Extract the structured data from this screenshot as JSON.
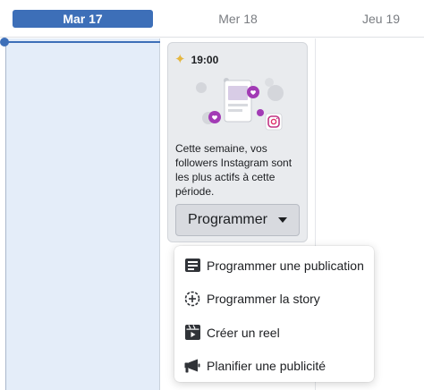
{
  "header": {
    "days": [
      {
        "label": "Mar 17",
        "active": true
      },
      {
        "label": "Mer 18",
        "active": false
      },
      {
        "label": "Jeu 19",
        "active": false
      }
    ]
  },
  "card": {
    "icon": "sparkle-icon",
    "time": "19:00",
    "text": "Cette semaine, vos followers Instagram sont les plus actifs à cette période.",
    "button_label": "Programmer"
  },
  "menu": {
    "items": [
      {
        "label": "Programmer une publication",
        "icon": "post-icon"
      },
      {
        "label": "Programmer la story",
        "icon": "story-icon"
      },
      {
        "label": "Créer un reel",
        "icon": "reel-icon"
      },
      {
        "label": "Planifier une publicité",
        "icon": "megaphone-icon"
      }
    ]
  },
  "colors": {
    "accent": "#3d6fb8",
    "today_column": "#e4edf9",
    "card_bg": "#e9ebee",
    "heart": "#a23bb5"
  }
}
